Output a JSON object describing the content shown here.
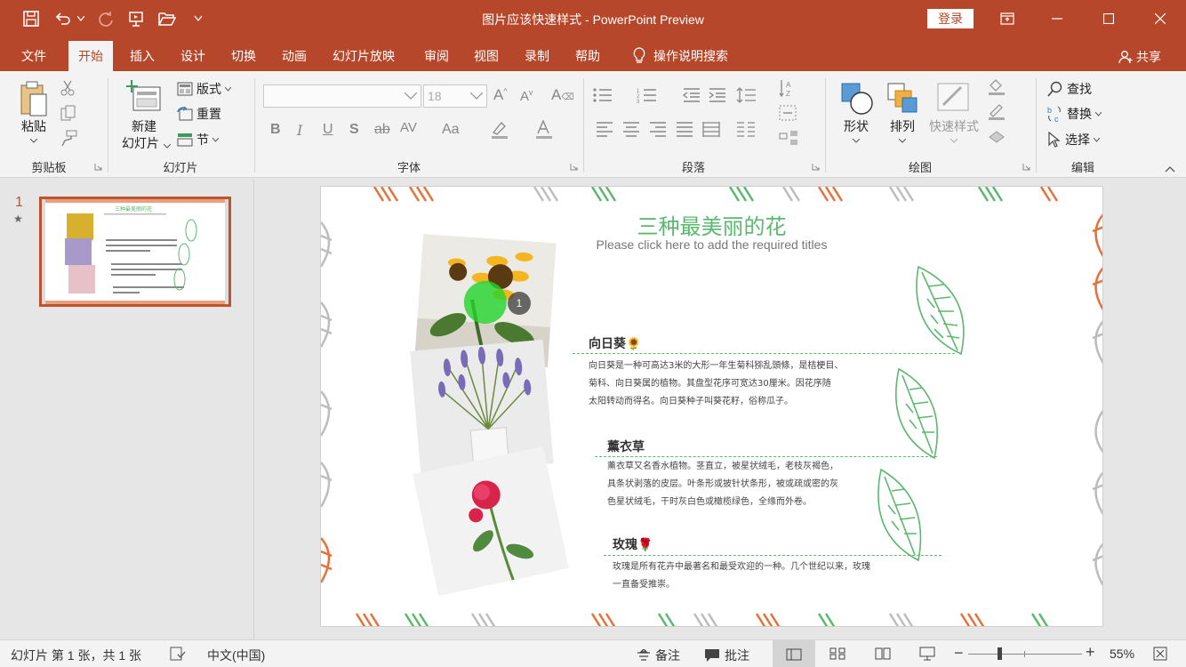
{
  "window": {
    "title": "图片应该快速样式 - PowerPoint Preview",
    "login_label": "登录",
    "share_label": "共享"
  },
  "tabs": [
    "文件",
    "开始",
    "插入",
    "设计",
    "切换",
    "动画",
    "幻灯片放映",
    "审阅",
    "视图",
    "录制",
    "帮助"
  ],
  "active_tab": "开始",
  "tell_me": "操作说明搜索",
  "ribbon": {
    "clipboard": {
      "paste": "粘贴",
      "label": "剪贴板"
    },
    "slides": {
      "new_slide_1": "新建",
      "new_slide_2": "幻灯片",
      "layout": "版式",
      "reset": "重置",
      "section": "节",
      "label": "幻灯片"
    },
    "font": {
      "size": "18",
      "label": "字体"
    },
    "paragraph": {
      "label": "段落"
    },
    "drawing": {
      "shapes": "形状",
      "arrange": "排列",
      "quick_styles": "快速样式",
      "label": "绘图"
    },
    "editing": {
      "find": "查找",
      "replace": "替换",
      "select": "选择",
      "label": "编辑"
    }
  },
  "thumbnail": {
    "number": "1",
    "star": "★"
  },
  "slide": {
    "title": "三种最美丽的花",
    "subtitle": "Please click here to add the required titles",
    "sections": [
      {
        "heading": "向日葵🌻",
        "text": [
          "向日葵是一种可高达3米的大形一年生菊科猕乱頭條，是桔梗目、",
          "菊科、向日葵属的植物。其盘型花序可宽达30厘米。因花序随",
          "太阳转动而得名。向日葵种子叫葵花籽，俗称瓜子。"
        ]
      },
      {
        "heading": "薰衣草",
        "text": [
          "薰衣草又名香水植物。茎直立，被星状绒毛，老枝灰褐色，",
          "具条状剥落的皮层。叶条形或披针状条形，被或疏或密的灰",
          "色星状绒毛，干时灰白色或橄榄绿色，全缘而外卷。"
        ]
      },
      {
        "heading": "玫瑰🌹",
        "text": [
          "玫瑰是所有花卉中最著名和最受欢迎的一种。几个世纪以来，玫瑰",
          "一直备受推崇。"
        ]
      }
    ],
    "badge": "1"
  },
  "status": {
    "slide_info": "幻灯片 第 1 张，共 1 张",
    "language": "中文(中国)",
    "notes": "备注",
    "comments": "批注",
    "zoom": "55%"
  },
  "colors": {
    "accent": "#b7472a",
    "green": "#5cb86f",
    "orange": "#e8703a"
  }
}
